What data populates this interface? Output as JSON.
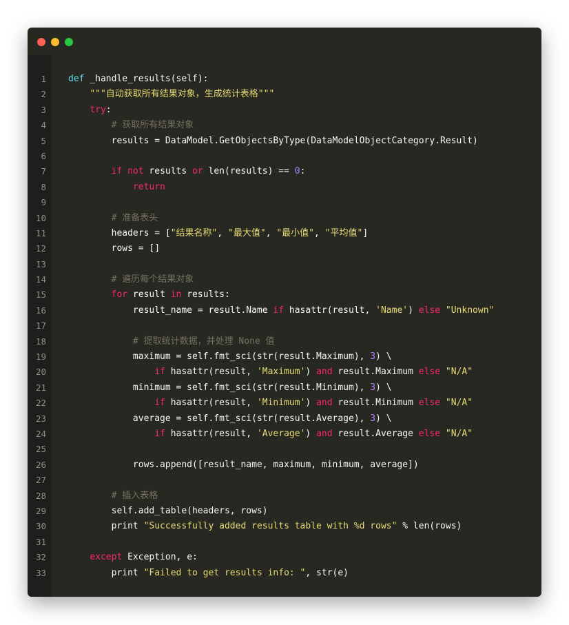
{
  "window": {
    "controls": [
      "close",
      "minimize",
      "maximize"
    ]
  },
  "colors": {
    "background": "#272822",
    "gutter": "#1e1f1c",
    "line_number": "#8f908a",
    "text": "#f8f8f2",
    "keyword": "#f92672",
    "definition": "#66d9ef",
    "string": "#e6db74",
    "number": "#ae81ff",
    "comment": "#75715e"
  },
  "code": {
    "lines": [
      {
        "n": "1",
        "t": [
          [
            "def",
            "def"
          ],
          [
            "",
            " _handle_results(self):"
          ]
        ]
      },
      {
        "n": "2",
        "t": [
          [
            "",
            "    "
          ],
          [
            "str",
            "\"\"\"自动获取所有结果对象，生成统计表格\"\"\""
          ]
        ]
      },
      {
        "n": "3",
        "t": [
          [
            "",
            "    "
          ],
          [
            "kw",
            "try"
          ],
          [
            "",
            ":"
          ]
        ]
      },
      {
        "n": "4",
        "t": [
          [
            "",
            "        "
          ],
          [
            "com",
            "# 获取所有结果对象"
          ]
        ]
      },
      {
        "n": "5",
        "t": [
          [
            "",
            "        results = DataModel.GetObjectsByType(DataModelObjectCategory.Result)"
          ]
        ]
      },
      {
        "n": "6",
        "t": []
      },
      {
        "n": "7",
        "t": [
          [
            "",
            "        "
          ],
          [
            "kw",
            "if"
          ],
          [
            "",
            " "
          ],
          [
            "kw",
            "not"
          ],
          [
            "",
            " results "
          ],
          [
            "kw",
            "or"
          ],
          [
            "",
            " len(results) == "
          ],
          [
            "num",
            "0"
          ],
          [
            "",
            ":"
          ]
        ]
      },
      {
        "n": "8",
        "t": [
          [
            "",
            "            "
          ],
          [
            "kw",
            "return"
          ]
        ]
      },
      {
        "n": "9",
        "t": []
      },
      {
        "n": "10",
        "t": [
          [
            "",
            "        "
          ],
          [
            "com",
            "# 准备表头"
          ]
        ]
      },
      {
        "n": "11",
        "t": [
          [
            "",
            "        headers = ["
          ],
          [
            "str",
            "\"结果名称\""
          ],
          [
            "",
            ", "
          ],
          [
            "str",
            "\"最大值\""
          ],
          [
            "",
            ", "
          ],
          [
            "str",
            "\"最小值\""
          ],
          [
            "",
            ", "
          ],
          [
            "str",
            "\"平均值\""
          ],
          [
            "",
            "]"
          ]
        ]
      },
      {
        "n": "12",
        "t": [
          [
            "",
            "        rows = []"
          ]
        ]
      },
      {
        "n": "13",
        "t": []
      },
      {
        "n": "14",
        "t": [
          [
            "",
            "        "
          ],
          [
            "com",
            "# 遍历每个结果对象"
          ]
        ]
      },
      {
        "n": "15",
        "t": [
          [
            "",
            "        "
          ],
          [
            "kw",
            "for"
          ],
          [
            "",
            " result "
          ],
          [
            "kw",
            "in"
          ],
          [
            "",
            " results:"
          ]
        ]
      },
      {
        "n": "16",
        "t": [
          [
            "",
            "            result_name = result.Name "
          ],
          [
            "kw",
            "if"
          ],
          [
            "",
            " hasattr(result, "
          ],
          [
            "str",
            "'Name'"
          ],
          [
            "",
            ") "
          ],
          [
            "kw",
            "else"
          ],
          [
            "",
            " "
          ],
          [
            "str",
            "\"Unknown\""
          ]
        ]
      },
      {
        "n": "17",
        "t": []
      },
      {
        "n": "18",
        "t": [
          [
            "",
            "            "
          ],
          [
            "com",
            "# 提取统计数据，并处理 None 值"
          ]
        ]
      },
      {
        "n": "19",
        "t": [
          [
            "",
            "            maximum = self.fmt_sci(str(result.Maximum), "
          ],
          [
            "num",
            "3"
          ],
          [
            "",
            ") \\"
          ]
        ]
      },
      {
        "n": "20",
        "t": [
          [
            "",
            "                "
          ],
          [
            "kw",
            "if"
          ],
          [
            "",
            " hasattr(result, "
          ],
          [
            "str",
            "'Maximum'"
          ],
          [
            "",
            ") "
          ],
          [
            "kw",
            "and"
          ],
          [
            "",
            " result.Maximum "
          ],
          [
            "kw",
            "else"
          ],
          [
            "",
            " "
          ],
          [
            "str",
            "\"N/A\""
          ]
        ]
      },
      {
        "n": "21",
        "t": [
          [
            "",
            "            minimum = self.fmt_sci(str(result.Minimum), "
          ],
          [
            "num",
            "3"
          ],
          [
            "",
            ") \\"
          ]
        ]
      },
      {
        "n": "22",
        "t": [
          [
            "",
            "                "
          ],
          [
            "kw",
            "if"
          ],
          [
            "",
            " hasattr(result, "
          ],
          [
            "str",
            "'Minimum'"
          ],
          [
            "",
            ") "
          ],
          [
            "kw",
            "and"
          ],
          [
            "",
            " result.Minimum "
          ],
          [
            "kw",
            "else"
          ],
          [
            "",
            " "
          ],
          [
            "str",
            "\"N/A\""
          ]
        ]
      },
      {
        "n": "23",
        "t": [
          [
            "",
            "            average = self.fmt_sci(str(result.Average), "
          ],
          [
            "num",
            "3"
          ],
          [
            "",
            ") \\"
          ]
        ]
      },
      {
        "n": "24",
        "t": [
          [
            "",
            "                "
          ],
          [
            "kw",
            "if"
          ],
          [
            "",
            " hasattr(result, "
          ],
          [
            "str",
            "'Average'"
          ],
          [
            "",
            ") "
          ],
          [
            "kw",
            "and"
          ],
          [
            "",
            " result.Average "
          ],
          [
            "kw",
            "else"
          ],
          [
            "",
            " "
          ],
          [
            "str",
            "\"N/A\""
          ]
        ]
      },
      {
        "n": "25",
        "t": []
      },
      {
        "n": "26",
        "t": [
          [
            "",
            "            rows.append([result_name, maximum, minimum, average])"
          ]
        ]
      },
      {
        "n": "27",
        "t": []
      },
      {
        "n": "28",
        "t": [
          [
            "",
            "        "
          ],
          [
            "com",
            "# 插入表格"
          ]
        ]
      },
      {
        "n": "29",
        "t": [
          [
            "",
            "        self.add_table(headers, rows)"
          ]
        ]
      },
      {
        "n": "30",
        "t": [
          [
            "",
            "        print "
          ],
          [
            "str",
            "\"Successfully added results table with %d rows\""
          ],
          [
            "",
            " % len(rows)"
          ]
        ]
      },
      {
        "n": "31",
        "t": []
      },
      {
        "n": "32",
        "t": [
          [
            "",
            "    "
          ],
          [
            "kw",
            "except"
          ],
          [
            "",
            " Exception, e:"
          ]
        ]
      },
      {
        "n": "33",
        "t": [
          [
            "",
            "        print "
          ],
          [
            "str",
            "\"Failed to get results info: \""
          ],
          [
            "",
            ", str(e)"
          ]
        ]
      }
    ]
  }
}
